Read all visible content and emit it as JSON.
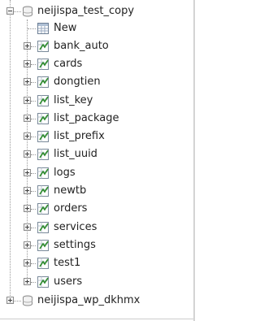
{
  "tree": {
    "databases": [
      {
        "name": "neijispa_test_copy",
        "state": "expanded",
        "children": [
          {
            "label": "New",
            "icon": "new-table-icon"
          },
          {
            "label": "bank_auto",
            "icon": "table-icon"
          },
          {
            "label": "cards",
            "icon": "table-icon"
          },
          {
            "label": "dongtien",
            "icon": "table-icon"
          },
          {
            "label": "list_key",
            "icon": "table-icon"
          },
          {
            "label": "list_package",
            "icon": "table-icon"
          },
          {
            "label": "list_prefix",
            "icon": "table-icon"
          },
          {
            "label": "list_uuid",
            "icon": "table-icon"
          },
          {
            "label": "logs",
            "icon": "table-icon"
          },
          {
            "label": "newtb",
            "icon": "table-icon"
          },
          {
            "label": "orders",
            "icon": "table-icon"
          },
          {
            "label": "services",
            "icon": "table-icon"
          },
          {
            "label": "settings",
            "icon": "table-icon"
          },
          {
            "label": "test1",
            "icon": "table-icon"
          },
          {
            "label": "users",
            "icon": "table-icon"
          }
        ]
      },
      {
        "name": "neijispa_wp_dkhmx",
        "state": "collapsed",
        "children": []
      }
    ]
  },
  "colors": {
    "text": "#222222",
    "tree_lines": "#9a9a9a",
    "table_icon_green": "#2e8b2e"
  }
}
